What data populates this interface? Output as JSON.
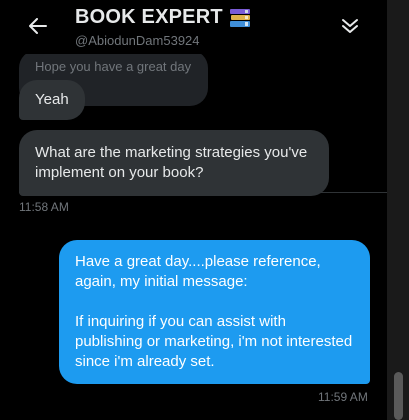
{
  "header": {
    "title": "BOOK EXPERT",
    "handle": "@AbiodunDam53924",
    "back_icon": "arrow-left-icon",
    "title_emoji": "books-icon",
    "collapse_icon": "double-chevron-down-icon"
  },
  "messages": {
    "quoted_text": "Hope you have a great day",
    "reply": "Yeah",
    "question": "What are the marketing strategies you've implement on your book?",
    "incoming_time": "11:58 AM",
    "answer": "Have a great day....please reference, again, my initial message:\n\nIf inquiring if you can assist with publishing or marketing, i'm not interested since i'm already set.",
    "outgoing_time": "11:59 AM"
  },
  "colors": {
    "background": "#000000",
    "incoming_bubble": "#2f3336",
    "outgoing_bubble": "#1d9bf0",
    "muted_text": "#71767b",
    "primary_text": "#e7e9ea"
  }
}
